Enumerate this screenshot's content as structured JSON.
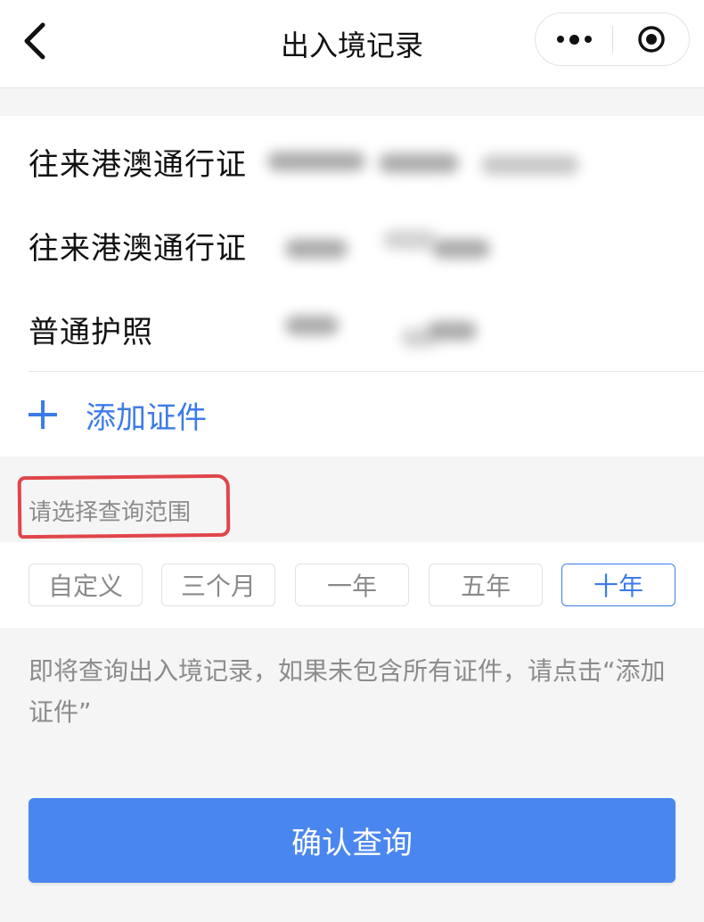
{
  "nav": {
    "title": "出入境记录"
  },
  "documents": [
    {
      "label": "往来港澳通行证"
    },
    {
      "label": "往来港澳通行证"
    },
    {
      "label": "普通护照"
    }
  ],
  "add_document": {
    "label": "添加证件"
  },
  "range": {
    "hint": "请选择查询范围",
    "options": [
      "自定义",
      "三个月",
      "一年",
      "五年",
      "十年"
    ],
    "selected": "十年"
  },
  "notice": "即将查询出入境记录，如果未包含所有证件，请点击“添加证件”",
  "confirm_button": "确认查询",
  "colors": {
    "accent": "#3d7be8",
    "button": "#4a86f0",
    "annotation": "#e0454a"
  }
}
